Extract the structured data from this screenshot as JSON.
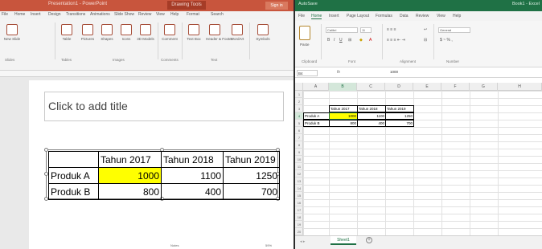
{
  "powerpoint": {
    "title_bar": {
      "app_title": "Presentation1 - PowerPoint",
      "context_tab": "Drawing Tools",
      "sign_in": "Sign in"
    },
    "tabs": [
      "File",
      "Home",
      "Insert",
      "Design",
      "Transitions",
      "Animations",
      "Slide Show",
      "Review",
      "View",
      "Help",
      "Format",
      "Search"
    ],
    "ribbon": {
      "buttons": [
        "New Slide",
        "Table",
        "Pictures",
        "Shapes",
        "Icons",
        "3D Models",
        "SmartArt",
        "Chart",
        "Comment",
        "Text Box",
        "Header & Footer",
        "WordArt",
        "Symbols"
      ],
      "groups": [
        "Slides",
        "Tables",
        "Images",
        "Illustrations",
        "Comments",
        "Text"
      ]
    },
    "slide": {
      "title_placeholder": "Click to add title",
      "table": {
        "headers": [
          "",
          "Tahun 2017",
          "Tahun 2018",
          "Tahun 2019"
        ],
        "rows": [
          {
            "label": "Produk A",
            "values": [
              "1000",
              "1100",
              "1250"
            ]
          },
          {
            "label": "Produk B",
            "values": [
              "800",
              "400",
              "700"
            ]
          }
        ]
      }
    },
    "status": {
      "notes": "Notes",
      "zoom": "59%"
    },
    "colors": {
      "title_bar": "#c8553d",
      "highlight": "#ffff00"
    }
  },
  "excel": {
    "title_bar": {
      "autosave": "AutoSave",
      "filename": "Book1 - Excel"
    },
    "tabs": [
      "File",
      "Home",
      "Insert",
      "Page Layout",
      "Formulas",
      "Data",
      "Review",
      "View",
      "Help"
    ],
    "active_tab": "Home",
    "ribbon": {
      "paste": "Paste",
      "font_name": "Calibri",
      "font_size": "11",
      "number_format": "General",
      "groups": [
        "Clipboard",
        "Font",
        "Alignment",
        "Number"
      ]
    },
    "formula_bar": {
      "name_box": "B4",
      "fx": "fx",
      "value": "1000"
    },
    "columns": [
      "A",
      "B",
      "C",
      "D",
      "E",
      "F",
      "G",
      "H"
    ],
    "rows": [
      "1",
      "2",
      "3",
      "4",
      "5",
      "6",
      "7",
      "8",
      "9",
      "10",
      "11",
      "12",
      "13",
      "14",
      "15",
      "16",
      "17",
      "18",
      "19",
      "20"
    ],
    "data": {
      "headers": [
        "",
        "Tahun 2017",
        "Tahun 2018",
        "Tahun 2019"
      ],
      "rows": [
        {
          "label": "Produk A",
          "values": [
            "1000",
            "1100",
            "1250"
          ]
        },
        {
          "label": "Produk B",
          "values": [
            "800",
            "400",
            "700"
          ]
        }
      ]
    },
    "sheet_tab": "Sheet1",
    "colors": {
      "title_bar": "#1f7145",
      "highlight": "#ffff00"
    }
  }
}
